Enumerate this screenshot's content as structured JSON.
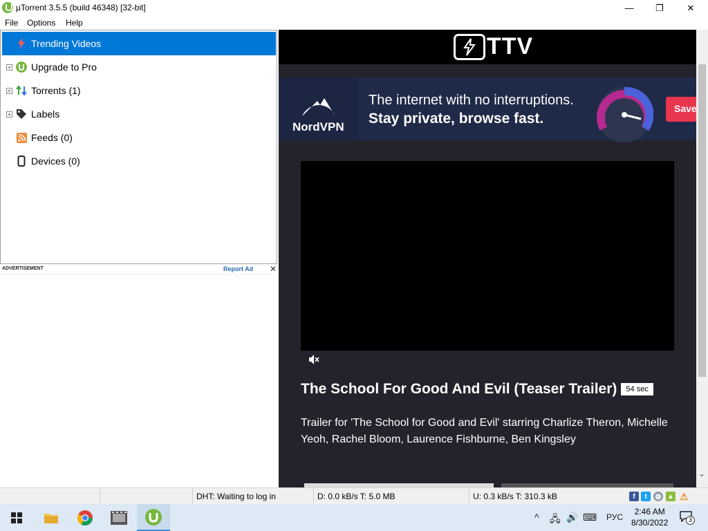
{
  "window": {
    "title": "µTorrent 3.5.5  (build 46348) [32-bit]",
    "minimize": "—",
    "maximize": "❐",
    "close": "✕"
  },
  "menu": [
    "File",
    "Options",
    "Help"
  ],
  "sidebar": {
    "items": [
      {
        "label": "Trending Videos",
        "icon": "lightning-icon",
        "selected": true
      },
      {
        "label": "Upgrade to Pro",
        "icon": "utorrent-icon"
      },
      {
        "label": "Torrents (1)",
        "icon": "updown-arrows-icon"
      },
      {
        "label": "Labels",
        "icon": "tag-icon"
      },
      {
        "label": "Feeds (0)",
        "icon": "rss-icon"
      },
      {
        "label": "Devices (0)",
        "icon": "device-icon"
      }
    ]
  },
  "ad": {
    "label": "ADVERTISEMENT",
    "report": "Report Ad",
    "close": "✕"
  },
  "ttv": {
    "logo_text": "TTV",
    "banner": {
      "brand": "NordVPN",
      "line1": "The internet with no interruptions.",
      "line2": "Stay private, browse fast.",
      "cta": "Save"
    },
    "video_title": "The School For Good And Evil (Teaser Trailer)",
    "duration": "54 sec",
    "description": "Trailer for 'The School for Good and Evil' starring Charlize Theron, Michelle Yeoh, Rachel Bloom, Laurence Fishburne, Ben Kingsley"
  },
  "status": {
    "dht": "DHT: Waiting to log in",
    "download": "D: 0.0 kB/s T: 5.0 MB",
    "upload": "U: 0.3 kB/s T: 310.3 kB"
  },
  "taskbar": {
    "lang": "РУС",
    "time": "2:46 AM",
    "date": "8/30/2022",
    "notifications": "3"
  },
  "colors": {
    "selection": "#0078d7",
    "ttv_bg": "#24232b",
    "nord_red": "#e8364e",
    "taskbar": "#dde9f5"
  }
}
